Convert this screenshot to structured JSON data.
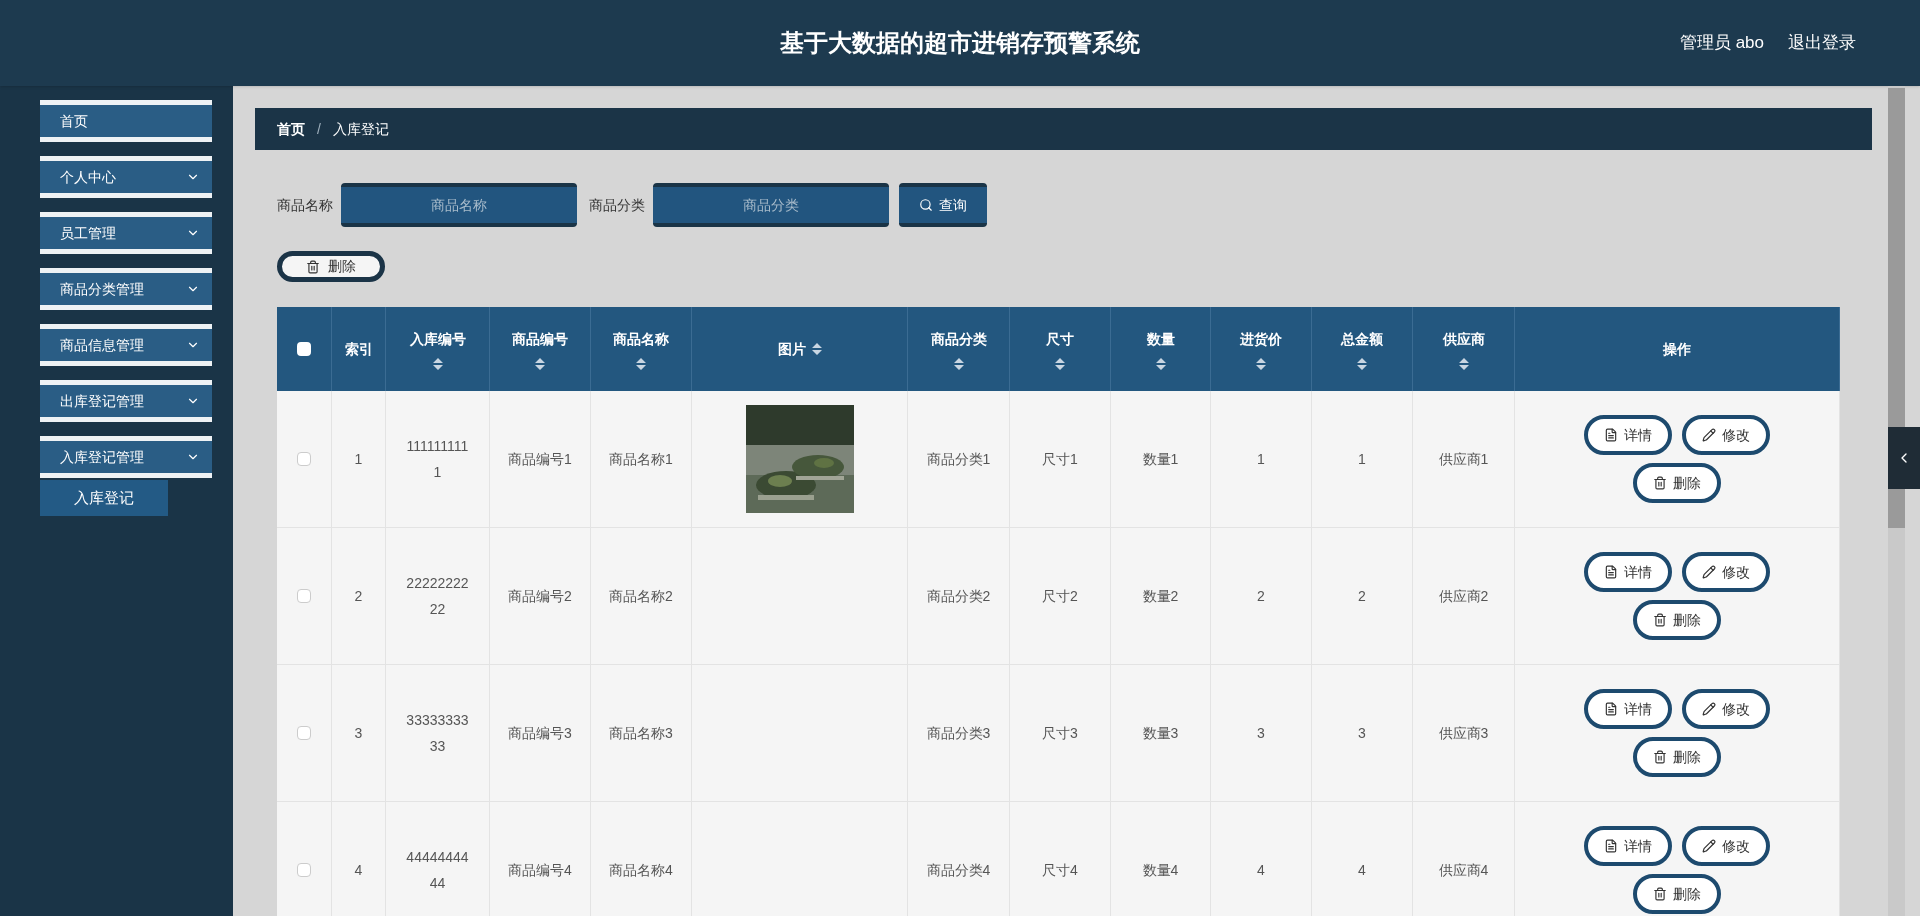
{
  "header": {
    "title": "基于大数据的超市进销存预警系统",
    "user": "管理员 abo",
    "logout": "退出登录"
  },
  "sidebar": {
    "items": [
      {
        "label": "首页",
        "expandable": false
      },
      {
        "label": "个人中心",
        "expandable": true
      },
      {
        "label": "员工管理",
        "expandable": true
      },
      {
        "label": "商品分类管理",
        "expandable": true
      },
      {
        "label": "商品信息管理",
        "expandable": true
      },
      {
        "label": "出库登记管理",
        "expandable": true
      },
      {
        "label": "入库登记管理",
        "expandable": true,
        "children": [
          {
            "label": "入库登记"
          }
        ]
      }
    ]
  },
  "breadcrumb": {
    "items": [
      "首页",
      "入库登记"
    ],
    "separator": "/"
  },
  "search": {
    "fields": [
      {
        "label": "商品名称",
        "placeholder": "商品名称"
      },
      {
        "label": "商品分类",
        "placeholder": "商品分类"
      }
    ],
    "button": "查询"
  },
  "delete_button": "删除",
  "table": {
    "columns": [
      {
        "kind": "checkbox",
        "sortable": false,
        "checked": false
      },
      {
        "label": "索引",
        "kind": "text",
        "sortable": false
      },
      {
        "label": "入库编号",
        "kind": "text",
        "sortable": true
      },
      {
        "label": "商品编号",
        "kind": "text",
        "sortable": true
      },
      {
        "label": "商品名称",
        "kind": "text",
        "sortable": true
      },
      {
        "label": "图片",
        "sortable": true
      },
      {
        "label": "商品分类",
        "kind": "text",
        "sortable": true
      },
      {
        "label": "尺寸",
        "kind": "text",
        "sortable": true
      },
      {
        "label": "数量",
        "kind": "text",
        "sortable": true
      },
      {
        "label": "进货价",
        "kind": "text",
        "sortable": true
      },
      {
        "label": "总金额",
        "kind": "text",
        "sortable": true
      },
      {
        "label": "供应商",
        "kind": "text",
        "sortable": true
      },
      {
        "label": "操作",
        "kind": "actions",
        "sortable": false
      }
    ],
    "rows": [
      {
        "checked": false,
        "index": "1",
        "entry_no": "1111111111",
        "product_no": "商品编号1",
        "product_name": "商品名称1",
        "has_image": true,
        "category": "商品分类1",
        "size": "尺寸1",
        "quantity": "数量1",
        "price": "1",
        "total": "1",
        "supplier": "供应商1",
        "actions": [
          "详情",
          "修改",
          "删除"
        ]
      },
      {
        "checked": false,
        "index": "2",
        "entry_no": "2222222222",
        "product_no": "商品编号2",
        "product_name": "商品名称2",
        "has_image": false,
        "category": "商品分类2",
        "size": "尺寸2",
        "quantity": "数量2",
        "price": "2",
        "total": "2",
        "supplier": "供应商2",
        "actions": [
          "详情",
          "修改",
          "删除"
        ]
      },
      {
        "checked": false,
        "index": "3",
        "entry_no": "3333333333",
        "product_no": "商品编号3",
        "product_name": "商品名称3",
        "has_image": false,
        "category": "商品分类3",
        "size": "尺寸3",
        "quantity": "数量3",
        "price": "3",
        "total": "3",
        "supplier": "供应商3",
        "actions": [
          "详情",
          "修改",
          "删除"
        ]
      },
      {
        "checked": false,
        "index": "4",
        "entry_no": "4444444444",
        "product_no": "商品编号4",
        "product_name": "商品名称4",
        "has_image": false,
        "category": "商品分类4",
        "size": "尺寸4",
        "quantity": "数量4",
        "price": "4",
        "total": "4",
        "supplier": "供应商4",
        "actions": [
          "详情",
          "修改",
          "删除"
        ]
      }
    ]
  }
}
